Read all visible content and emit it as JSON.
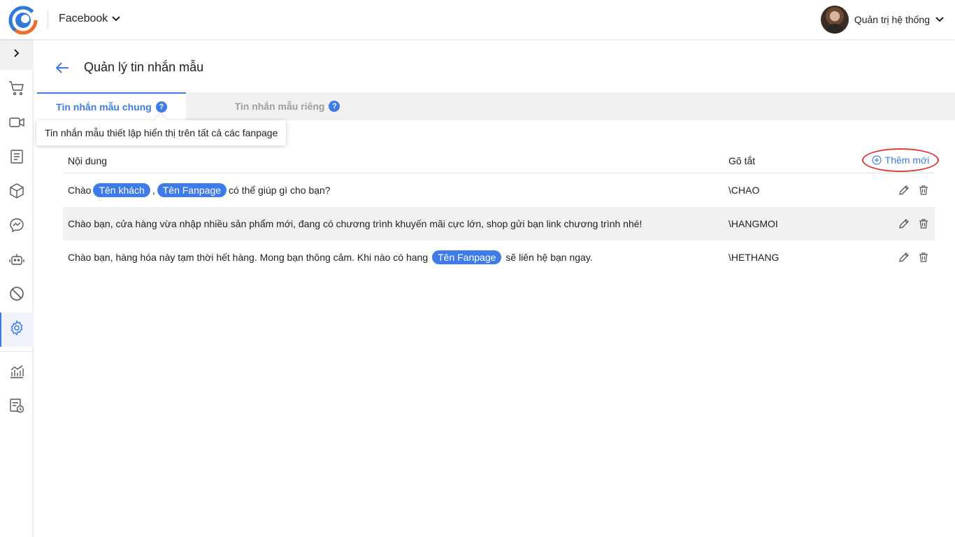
{
  "header": {
    "channel": "Facebook",
    "user_name": "Quản trị hệ thống"
  },
  "sidebar": {
    "items": [
      {
        "icon": "cart-icon"
      },
      {
        "icon": "video-icon"
      },
      {
        "icon": "document-icon"
      },
      {
        "icon": "box-icon"
      },
      {
        "icon": "messenger-icon"
      },
      {
        "icon": "robot-icon"
      },
      {
        "icon": "block-icon"
      },
      {
        "icon": "gear-icon",
        "active": true
      },
      {
        "icon": "chart-icon"
      },
      {
        "icon": "report-clock-icon"
      }
    ]
  },
  "page": {
    "title": "Quản lý tin nhắn mẫu"
  },
  "tabs": [
    {
      "label": "Tin nhắn mẫu chung",
      "active": true
    },
    {
      "label": "Tin nhắn mẫu riêng",
      "active": false
    }
  ],
  "tooltip": "Tin nhắn mẫu thiết lập hiển thị trên tất cả các fanpage",
  "table": {
    "col_content": "Nội dung",
    "col_shortcut": "Gõ tắt",
    "add_label": "Thêm mới",
    "rows": [
      {
        "parts": [
          "Chào",
          "Tên khách",
          ",",
          "Tên Fanpage",
          "có thể giúp gì cho bạn?"
        ],
        "shortcut": "\\CHAO"
      },
      {
        "parts": [
          "Chào bạn, cửa hàng vừa nhập nhiều sản phẩm mới, đang có chương trình khuyến mãi cực lớn, shop gửi bạn link chương trình nhé!"
        ],
        "shortcut": "\\HANGMOI"
      },
      {
        "parts": [
          "Chào bạn, hàng hóa này tạm thời hết hàng. Mong bạn thông cảm. Khi nào có hang",
          "Tên Fanpage",
          "sẽ liên hệ bạn ngay."
        ],
        "shortcut": "\\HETHANG"
      }
    ]
  },
  "colors": {
    "accent": "#3e7be6",
    "highlight_circle": "#e23a3a",
    "tab_bar_bg": "#f1f1f1"
  }
}
